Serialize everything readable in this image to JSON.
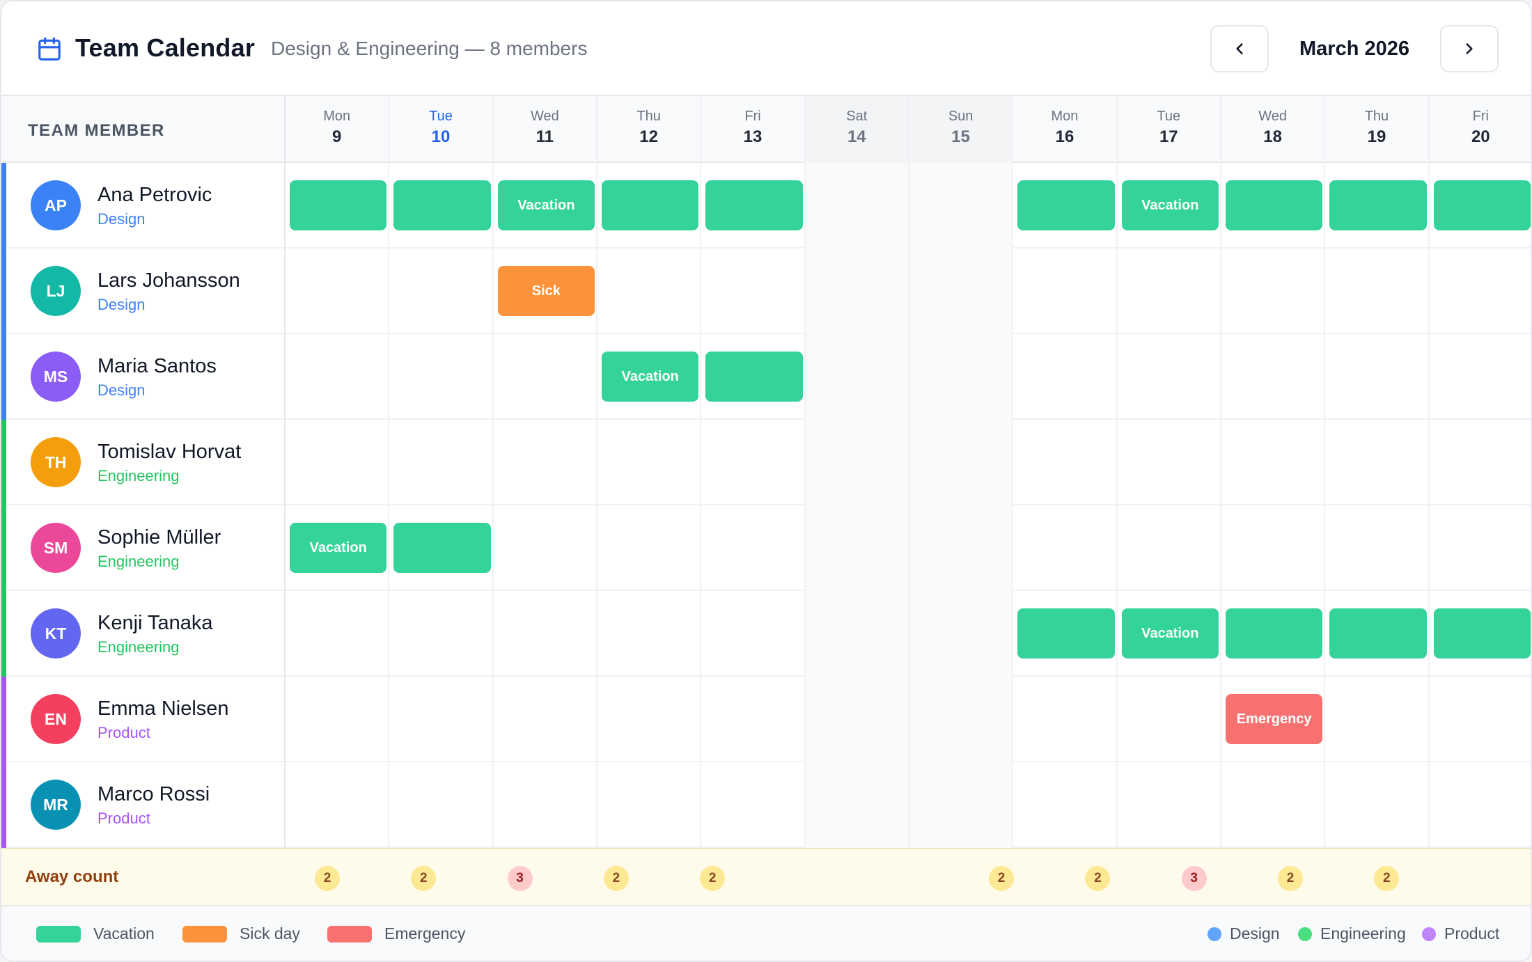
{
  "header": {
    "title": "Team Calendar",
    "subtitle": "Design & Engineering — 8 members",
    "month_label": "March 2026",
    "prev_icon": "chevron-left-icon",
    "next_icon": "chevron-right-icon"
  },
  "grid": {
    "member_column_header": "TEAM MEMBER",
    "days": [
      {
        "name": "Mon",
        "num": "9",
        "weekend": false,
        "today": false
      },
      {
        "name": "Tue",
        "num": "10",
        "weekend": false,
        "today": true
      },
      {
        "name": "Wed",
        "num": "11",
        "weekend": false,
        "today": false
      },
      {
        "name": "Thu",
        "num": "12",
        "weekend": false,
        "today": false
      },
      {
        "name": "Fri",
        "num": "13",
        "weekend": false,
        "today": false
      },
      {
        "name": "Sat",
        "num": "14",
        "weekend": true,
        "today": false
      },
      {
        "name": "Sun",
        "num": "15",
        "weekend": true,
        "today": false
      },
      {
        "name": "Mon",
        "num": "16",
        "weekend": false,
        "today": false
      },
      {
        "name": "Tue",
        "num": "17",
        "weekend": false,
        "today": false
      },
      {
        "name": "Wed",
        "num": "18",
        "weekend": false,
        "today": false
      },
      {
        "name": "Thu",
        "num": "19",
        "weekend": false,
        "today": false
      },
      {
        "name": "Fri",
        "num": "20",
        "weekend": false,
        "today": false
      }
    ]
  },
  "teams": {
    "Design": "#3b82f6",
    "Engineering": "#22c55e",
    "Product": "#a855f7"
  },
  "leave_types": {
    "vacation": {
      "label": "Vacation",
      "color": "#34d399"
    },
    "sick": {
      "label": "Sick",
      "color": "#fb923c"
    },
    "emergency": {
      "label": "Emergency",
      "color": "#f87171"
    }
  },
  "members": [
    {
      "initials": "AP",
      "name": "Ana Petrovic",
      "team": "Design",
      "avatar_color": "#3b82f6",
      "leave": [
        {
          "type": "vacation",
          "days": [
            0,
            1,
            2,
            3,
            4
          ],
          "label_day": 2
        },
        {
          "type": "vacation",
          "days": [
            7,
            8,
            9,
            10,
            11
          ],
          "label_day": 8
        }
      ]
    },
    {
      "initials": "LJ",
      "name": "Lars Johansson",
      "team": "Design",
      "avatar_color": "#14b8a6",
      "leave": [
        {
          "type": "sick",
          "days": [
            2
          ],
          "label_day": 2
        }
      ]
    },
    {
      "initials": "MS",
      "name": "Maria Santos",
      "team": "Design",
      "avatar_color": "#8b5cf6",
      "leave": [
        {
          "type": "vacation",
          "days": [
            3,
            4
          ],
          "label_day": 3
        }
      ]
    },
    {
      "initials": "TH",
      "name": "Tomislav Horvat",
      "team": "Engineering",
      "avatar_color": "#f59e0b",
      "leave": []
    },
    {
      "initials": "SM",
      "name": "Sophie Müller",
      "team": "Engineering",
      "avatar_color": "#ec4899",
      "leave": [
        {
          "type": "vacation",
          "days": [
            0,
            1
          ],
          "label_day": 0
        }
      ]
    },
    {
      "initials": "KT",
      "name": "Kenji Tanaka",
      "team": "Engineering",
      "avatar_color": "#6366f1",
      "leave": [
        {
          "type": "vacation",
          "days": [
            7,
            8,
            9,
            10,
            11
          ],
          "label_day": 8
        }
      ]
    },
    {
      "initials": "EN",
      "name": "Emma Nielsen",
      "team": "Product",
      "avatar_color": "#f43f5e",
      "leave": [
        {
          "type": "emergency",
          "days": [
            9
          ],
          "label_day": 9
        }
      ]
    },
    {
      "initials": "MR",
      "name": "Marco Rossi",
      "team": "Product",
      "avatar_color": "#0891b2",
      "leave": []
    }
  ],
  "away_count": {
    "label": "Away count",
    "counts": [
      "2",
      "2",
      "3",
      "2",
      "2",
      null,
      null,
      "2",
      "2",
      "3",
      "2",
      "2"
    ],
    "high": [
      false,
      false,
      true,
      false,
      false,
      false,
      false,
      false,
      false,
      true,
      false,
      false
    ]
  },
  "legend": {
    "leave": [
      {
        "label": "Vacation",
        "color": "#34d399"
      },
      {
        "label": "Sick day",
        "color": "#fb923c"
      },
      {
        "label": "Emergency",
        "color": "#f87171"
      }
    ],
    "teams": [
      {
        "label": "Design",
        "color": "#60a5fa"
      },
      {
        "label": "Engineering",
        "color": "#4ade80"
      },
      {
        "label": "Product",
        "color": "#c084fc"
      }
    ]
  }
}
